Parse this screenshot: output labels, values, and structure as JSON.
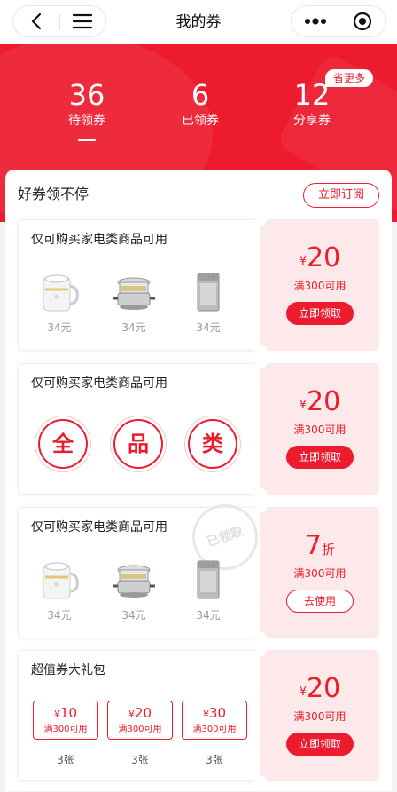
{
  "nav": {
    "title": "我的券",
    "icons": [
      "chevron-left-icon",
      "menu-icon",
      "more-dots-icon",
      "record-icon"
    ]
  },
  "header": {
    "stats": [
      {
        "value": "36",
        "label": "待领券"
      },
      {
        "value": "6",
        "label": "已领券"
      },
      {
        "value": "12",
        "label": "分享券"
      }
    ],
    "more_tag": "省更多",
    "colors": {
      "brand": "#ec1b2e",
      "ticket_bg": "#fde9ea"
    }
  },
  "section": {
    "title": "好券领不停",
    "subscribe_label": "立即订阅"
  },
  "coupons": [
    {
      "name": "仅可购买家电类商品可用",
      "currency": "¥",
      "amount": "20",
      "condition": "满300可用",
      "action": "立即领取",
      "products": [
        {
          "icon": "kettle-icon",
          "price": "34元"
        },
        {
          "icon": "steamer-pot-icon",
          "price": "34元"
        },
        {
          "icon": "washing-machine-icon",
          "price": "34元"
        }
      ]
    },
    {
      "name": "仅可购买家电类商品可用",
      "currency": "¥",
      "amount": "20",
      "condition": "满300可用",
      "action": "立即领取",
      "chars": [
        "全",
        "品",
        "类"
      ]
    },
    {
      "name": "仅可购买家电类商品可用",
      "amount": "7",
      "unit": "折",
      "condition": "满300可用",
      "action": "去使用",
      "stamp": "已领取",
      "products": [
        {
          "icon": "kettle-icon",
          "price": "34元"
        },
        {
          "icon": "steamer-pot-icon",
          "price": "34元"
        },
        {
          "icon": "washing-machine-icon",
          "price": "34元"
        }
      ]
    },
    {
      "name": "超值券大礼包",
      "currency": "¥",
      "amount": "20",
      "condition": "满300可用",
      "action": "立即领取",
      "bundle": [
        {
          "currency": "¥",
          "amount": "10",
          "condition": "满300可用",
          "count": "3张"
        },
        {
          "currency": "¥",
          "amount": "20",
          "condition": "满300可用",
          "count": "3张"
        },
        {
          "currency": "¥",
          "amount": "30",
          "condition": "满300可用",
          "count": "3张"
        }
      ]
    }
  ]
}
